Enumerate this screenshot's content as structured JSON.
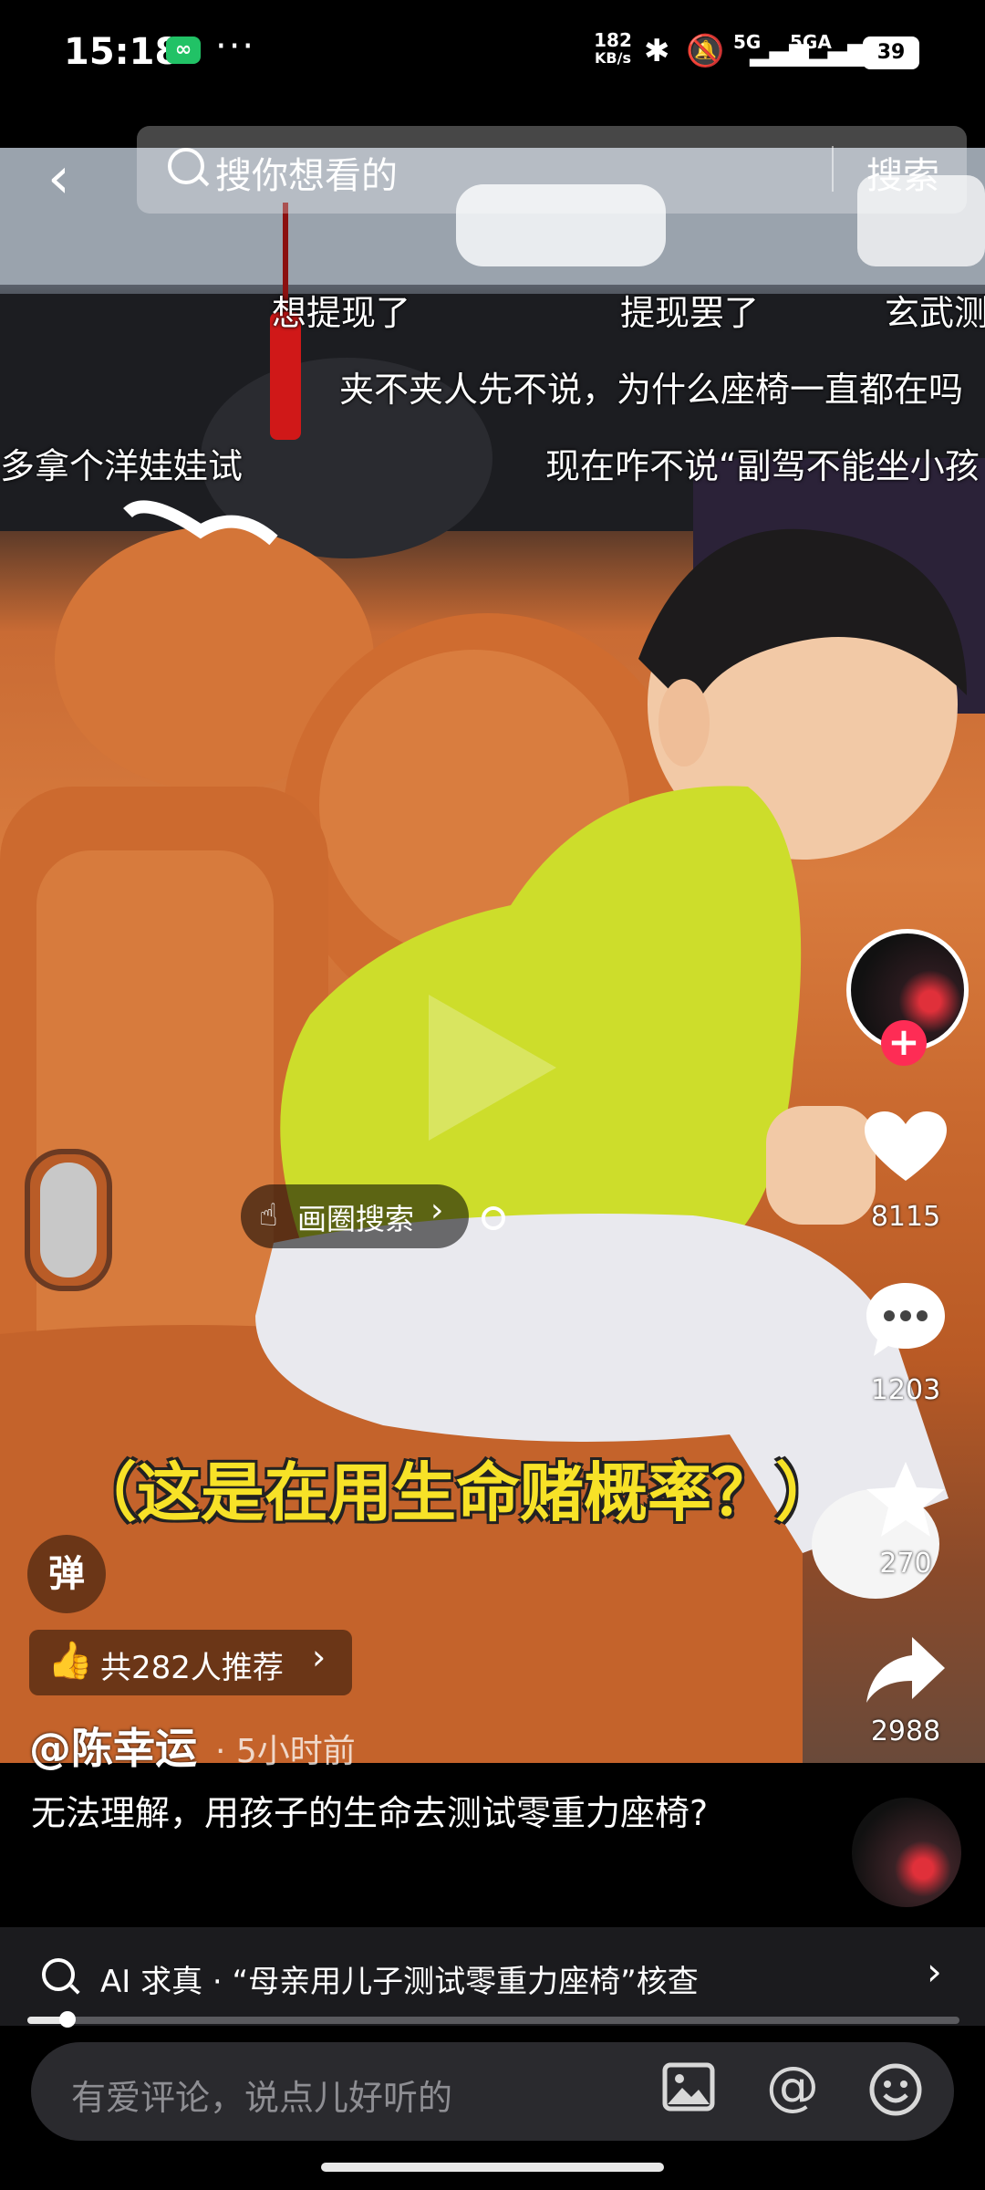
{
  "status_bar": {
    "time": "15:18",
    "app_badge": "∞",
    "more": "···",
    "net_speed_value": "182",
    "net_speed_unit": "KB/s",
    "signal_1": "5G",
    "signal_2": "5GA",
    "battery": "39"
  },
  "search": {
    "placeholder": "搜你想看的",
    "button_label": "搜索"
  },
  "danmaku": [
    "想提现了",
    "提现罢了",
    "玄武测",
    "夹不夹人先不说，为什么座椅一直都在吗",
    "多拿个洋娃娃试",
    "现在咋不说“副驾不能坐小孩"
  ],
  "rail": {
    "like_count": "8115",
    "comment_count": "1203",
    "favorite_count": "270",
    "share_count": "2988"
  },
  "lens_search_label": "画圈搜索",
  "subtitle": "（这是在用生命赌概率？）",
  "danmu_toggle_label": "弹",
  "recommend_label": "共282人推荐",
  "author": "@陈幸运",
  "post_time": "· 5小时前",
  "caption": "无法理解，用孩子的生命去测试零重力座椅?",
  "ai_bar_text": "AI 求真 · “母亲用儿子测试零重力座椅”核查",
  "progress": 0.043,
  "comment_placeholder": "有爱评论，说点儿好听的",
  "colors": {
    "subtitle": "#f7e227",
    "follow": "#fe2c55",
    "accent_seat": "#c96b34"
  }
}
